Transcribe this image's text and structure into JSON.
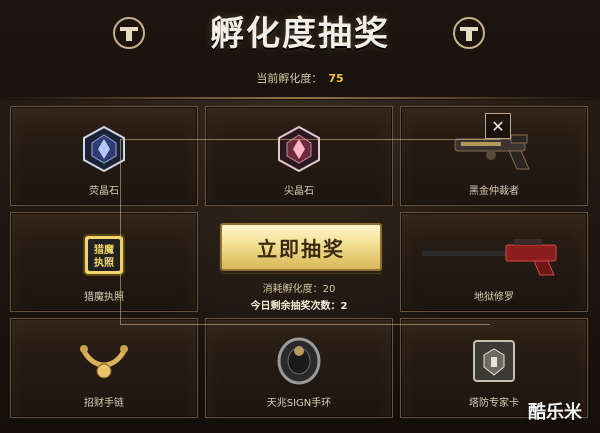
{
  "header": {
    "title": "孵化度抽奖",
    "incubation_label": "当前孵化度：",
    "incubation_value": "75"
  },
  "draw": {
    "button_label": "立即抽奖",
    "cost_text": "消耗孵化度：20",
    "remaining_text": "今日剩余抽奖次数：2"
  },
  "prizes": [
    {
      "name": "荧晶石",
      "icon": "blue-crystal-icon"
    },
    {
      "name": "尖晶石",
      "icon": "pink-crystal-icon"
    },
    {
      "name": "黑金仲裁者",
      "icon": "pistol-icon"
    },
    {
      "name": "猎魔执照",
      "icon": "license-icon",
      "icon_text": "猎魔执照"
    },
    {
      "name": "地狱修罗",
      "icon": "rifle-icon"
    },
    {
      "name": "招财手链",
      "icon": "bracelet-icon"
    },
    {
      "name": "天兆SIGN手环",
      "icon": "wristband-icon"
    },
    {
      "name": "塔防专家卡",
      "icon": "card-icon"
    }
  ],
  "watermark": "酷乐米",
  "colors": {
    "accent_gold": "#f5c33b",
    "button_gold": "#f1de8f",
    "card_border": "#6b523a"
  }
}
